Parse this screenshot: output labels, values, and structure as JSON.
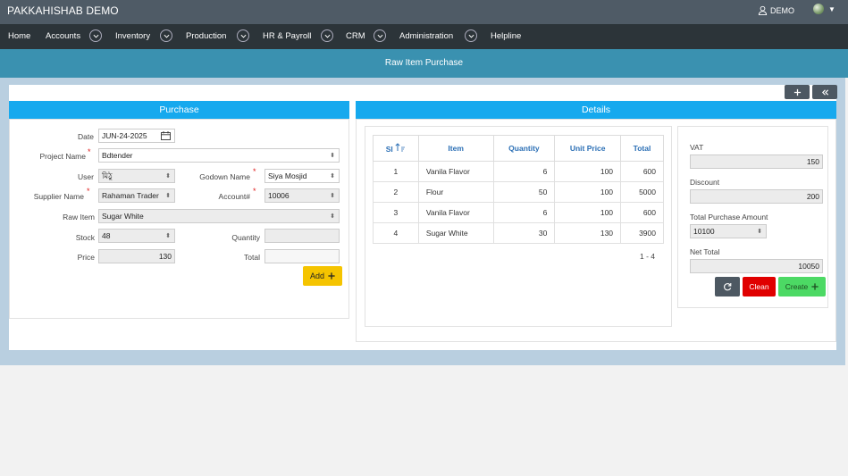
{
  "app": {
    "title": "PAKKAHISHAB DEMO",
    "user": "DEMO"
  },
  "nav": {
    "items": [
      "Home",
      "Accounts",
      "Inventory",
      "Production",
      "HR & Payroll",
      "CRM",
      "Administration",
      "Helpline"
    ]
  },
  "page": {
    "title": "Raw Item Purchase"
  },
  "purchase": {
    "heading": "Purchase",
    "date_label": "Date",
    "date_value": "JUN-24-2025",
    "project_label": "Project Name",
    "project_value": "Bdtender",
    "user_label": "User",
    "user_value": "মিঠু",
    "godown_label": "Godown Name",
    "godown_value": "Siya Mosjid",
    "supplier_label": "Supplier Name",
    "supplier_value": "Rahaman Trader",
    "account_label": "Account#",
    "account_value": "10006",
    "rawitem_label": "Raw Item",
    "rawitem_value": "Sugar White",
    "stock_label": "Stock",
    "stock_value": "48",
    "quantity_label": "Quantity",
    "quantity_value": "",
    "price_label": "Price",
    "price_value": "130",
    "total_label": "Total",
    "total_value": "",
    "add_label": "Add"
  },
  "details": {
    "heading": "Details",
    "columns": [
      "Sl",
      "Item",
      "Quantity",
      "Unit Price",
      "Total"
    ],
    "rows": [
      {
        "sl": "1",
        "item": "Vanila Flavor",
        "quantity": "6",
        "unit_price": "100",
        "total": "600"
      },
      {
        "sl": "2",
        "item": "Flour",
        "quantity": "50",
        "unit_price": "100",
        "total": "5000"
      },
      {
        "sl": "3",
        "item": "Vanila Flavor",
        "quantity": "6",
        "unit_price": "100",
        "total": "600"
      },
      {
        "sl": "4",
        "item": "Sugar White",
        "quantity": "30",
        "unit_price": "130",
        "total": "3900"
      }
    ],
    "pager": "1 - 4"
  },
  "summary": {
    "vat_label": "VAT",
    "vat_value": "150",
    "discount_label": "Discount",
    "discount_value": "200",
    "tpa_label": "Total Purchase Amount",
    "tpa_value": "10100",
    "net_label": "Net Total",
    "net_value": "10050",
    "clean_label": "Clean",
    "create_label": "Create"
  },
  "colors": {
    "accent": "#16a9ee",
    "clean": "#e00000",
    "create": "#4cd964",
    "add": "#f5c400"
  }
}
